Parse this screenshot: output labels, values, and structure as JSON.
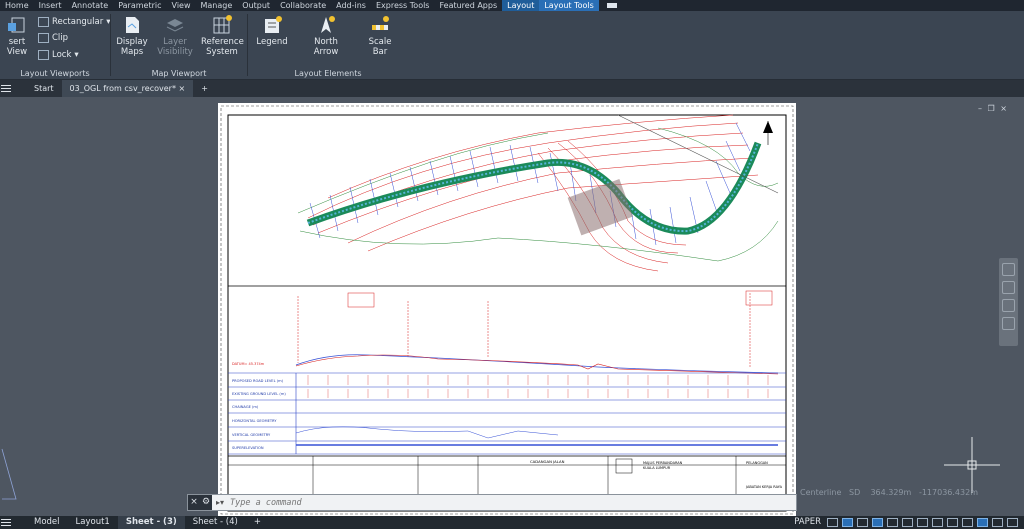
{
  "ribbon_tabs": [
    "Home",
    "Insert",
    "Annotate",
    "Parametric",
    "View",
    "Manage",
    "Output",
    "Collaborate",
    "Add-ins",
    "Express Tools",
    "Featured Apps",
    "Layout",
    "Layout Tools"
  ],
  "ribbon": {
    "insert_view": "sert View",
    "rectangular": "Rectangular",
    "clip": "Clip",
    "lock": "Lock",
    "group_viewports": "Layout Viewports",
    "display_maps_1": "Display",
    "display_maps_2": "Maps",
    "layer_vis_1": "Layer",
    "layer_vis_2": "Visibility",
    "ref_sys_1": "Reference",
    "ref_sys_2": "System",
    "group_map_viewport": "Map Viewport",
    "legend": "Legend",
    "north_1": "North",
    "north_2": "Arrow",
    "scale_1": "Scale",
    "scale_2": "Bar",
    "group_layout_elements": "Layout Elements"
  },
  "doc_tabs": {
    "start": "Start",
    "current": "03_OGL from csv_recover*"
  },
  "profile": {
    "rows": [
      "PROPOSED ROAD LEVEL (m)",
      "EXISTING GROUND LEVEL (m)",
      "CHAINAGE (m)",
      "HORIZONTAL GEOMETRY",
      "VERTICAL GEOMETRY",
      "SUPERELEVATION"
    ],
    "datum": "DATUM= 45.374m"
  },
  "title_block": {
    "project": "CADANGAN JALAN",
    "authority_1": "MAJLIS PERBANDARAN",
    "authority_2": "KUALA LUMPUR",
    "dept_1": "PELANGGAN",
    "dept_2": "JABATAN KERJA RAYA"
  },
  "command": {
    "placeholder": "Type a command"
  },
  "coords": {
    "label": "Centerline",
    "value": "SD",
    "x": "364.329m",
    "y": "-117036.432m"
  },
  "layout_tabs": [
    "Model",
    "Layout1",
    "Sheet - (3)",
    "Sheet - (4)"
  ],
  "status": {
    "paper": "PAPER"
  },
  "colors": {
    "accent": "#2a6fb6",
    "road": "#1b8a5a",
    "contour": "#d81e1e",
    "grid": "#2b44c7"
  }
}
